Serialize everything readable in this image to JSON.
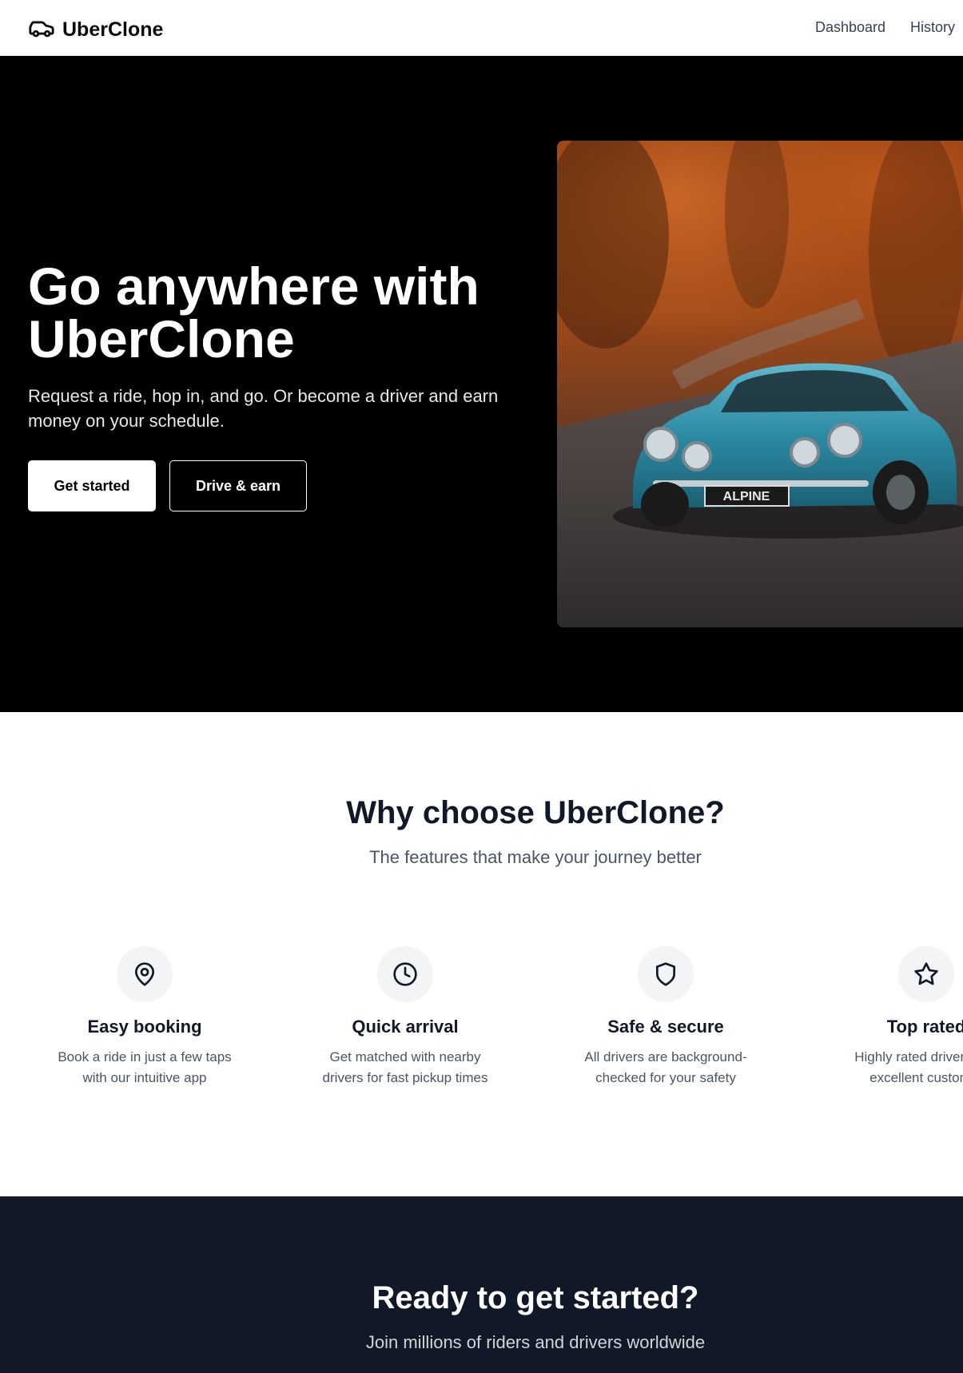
{
  "navbar": {
    "brand": "UberClone",
    "links": [
      {
        "label": "Dashboard"
      },
      {
        "label": "History"
      }
    ]
  },
  "hero": {
    "title": "Go anywhere with UberClone",
    "subtitle": "Request a ride, hop in, and go. Or become a driver and earn money on your schedule.",
    "primary_button": "Get started",
    "secondary_button": "Drive & earn",
    "image_plate": "ALPINE"
  },
  "features": {
    "title": "Why choose UberClone?",
    "subtitle": "The features that make your journey better",
    "items": [
      {
        "icon": "map-pin-icon",
        "title": "Easy booking",
        "description": "Book a ride in just a few taps with our intuitive app"
      },
      {
        "icon": "clock-icon",
        "title": "Quick arrival",
        "description": "Get matched with nearby drivers for fast pickup times"
      },
      {
        "icon": "shield-icon",
        "title": "Safe & secure",
        "description": "All drivers are background-checked for your safety"
      },
      {
        "icon": "star-icon",
        "title": "Top rated",
        "description": "Highly rated drivers and excellent customer"
      }
    ]
  },
  "cta": {
    "title": "Ready to get started?",
    "subtitle": "Join millions of riders and drivers worldwide"
  },
  "colors": {
    "hero_bg": "#000000",
    "cta_bg": "#111827",
    "icon_circle_bg": "#f3f4f6"
  }
}
